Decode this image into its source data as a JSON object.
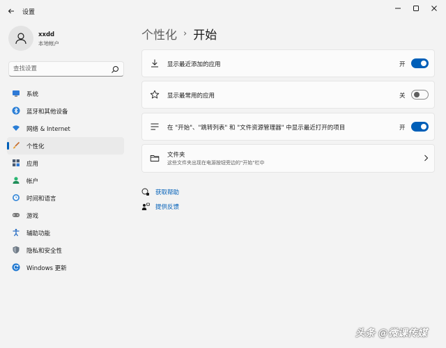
{
  "window": {
    "title": "设置"
  },
  "user": {
    "name": "xxdd",
    "account_type": "本地帐户"
  },
  "search": {
    "placeholder": "查找设置"
  },
  "sidebar": {
    "items": [
      {
        "label": "系统",
        "icon": "system-icon"
      },
      {
        "label": "蓝牙和其他设备",
        "icon": "bluetooth-icon"
      },
      {
        "label": "网络 & Internet",
        "icon": "wifi-icon"
      },
      {
        "label": "个性化",
        "icon": "brush-icon",
        "active": true
      },
      {
        "label": "应用",
        "icon": "apps-icon"
      },
      {
        "label": "帐户",
        "icon": "account-icon"
      },
      {
        "label": "时间和语言",
        "icon": "time-language-icon"
      },
      {
        "label": "游戏",
        "icon": "gaming-icon"
      },
      {
        "label": "辅助功能",
        "icon": "accessibility-icon"
      },
      {
        "label": "隐私和安全性",
        "icon": "shield-icon"
      },
      {
        "label": "Windows 更新",
        "icon": "update-icon"
      }
    ]
  },
  "breadcrumb": {
    "parent": "个性化",
    "separator": "›",
    "current": "开始"
  },
  "settings": [
    {
      "label": "显示最近添加的应用",
      "state_label": "开",
      "on": true,
      "icon": "download-icon"
    },
    {
      "label": "显示最常用的应用",
      "state_label": "关",
      "on": false,
      "icon": "star-icon"
    },
    {
      "label": "在 \"开始\"、\"跳转列表\" 和 \"文件资源管理器\" 中显示最近打开的项目",
      "state_label": "开",
      "on": true,
      "icon": "list-icon"
    }
  ],
  "folders": {
    "title": "文件夹",
    "subtitle": "这些文件夹出现在电源按钮旁边的\"开始\"栏中"
  },
  "links": {
    "help": "获取帮助",
    "feedback": "提供反馈"
  },
  "watermark": {
    "text": "头条 @微课传媒"
  },
  "colors": {
    "accent": "#005fb8",
    "background": "#f3f3f3",
    "card": "#fbfbfb"
  }
}
